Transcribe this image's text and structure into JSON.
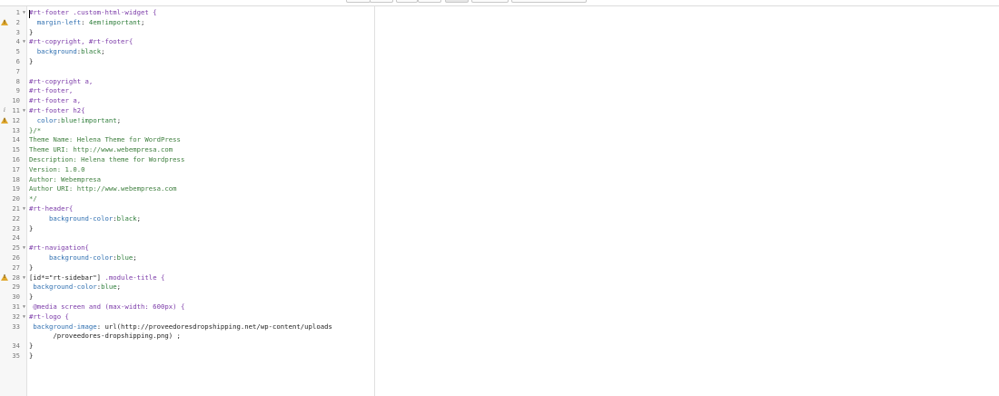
{
  "toolbar": {
    "buttons": [
      "",
      "",
      "",
      "",
      "",
      "",
      ""
    ]
  },
  "editor": {
    "lines": [
      {
        "num": "1",
        "fold": true,
        "parts": [
          {
            "t": "#rt-footer .custom-html-widget {",
            "c": "c-sel"
          }
        ]
      },
      {
        "num": "2",
        "warn": true,
        "parts": [
          {
            "t": "  margin-left",
            "c": "c-prop"
          },
          {
            "t": ": ",
            "c": "c-plain"
          },
          {
            "t": "4em!important",
            "c": "c-val"
          },
          {
            "t": ";",
            "c": "c-plain"
          }
        ]
      },
      {
        "num": "3",
        "parts": [
          {
            "t": "}",
            "c": "c-plain"
          }
        ]
      },
      {
        "num": "4",
        "fold": true,
        "parts": [
          {
            "t": "#rt-copyright, #rt-footer{",
            "c": "c-sel"
          }
        ]
      },
      {
        "num": "5",
        "parts": [
          {
            "t": "  background",
            "c": "c-prop"
          },
          {
            "t": ":",
            "c": "c-plain"
          },
          {
            "t": "black",
            "c": "c-val"
          },
          {
            "t": ";",
            "c": "c-plain"
          }
        ]
      },
      {
        "num": "6",
        "parts": [
          {
            "t": "}",
            "c": "c-plain"
          }
        ]
      },
      {
        "num": "7",
        "parts": [
          {
            "t": "",
            "c": "c-plain"
          }
        ]
      },
      {
        "num": "8",
        "parts": [
          {
            "t": "#rt-copyright a,",
            "c": "c-sel"
          }
        ]
      },
      {
        "num": "9",
        "parts": [
          {
            "t": "#rt-footer,",
            "c": "c-sel"
          }
        ]
      },
      {
        "num": "10",
        "parts": [
          {
            "t": "#rt-footer a,",
            "c": "c-sel"
          }
        ]
      },
      {
        "num": "11",
        "fold": true,
        "info": true,
        "parts": [
          {
            "t": "#rt-footer h2{",
            "c": "c-sel"
          }
        ]
      },
      {
        "num": "12",
        "warn": true,
        "parts": [
          {
            "t": "  color",
            "c": "c-prop"
          },
          {
            "t": ":",
            "c": "c-plain"
          },
          {
            "t": "blue!important",
            "c": "c-val"
          },
          {
            "t": ";",
            "c": "c-plain"
          }
        ]
      },
      {
        "num": "13",
        "parts": [
          {
            "t": "}/*",
            "c": "c-com"
          }
        ]
      },
      {
        "num": "14",
        "parts": [
          {
            "t": "Theme Name: Helena Theme for WordPress",
            "c": "c-com"
          }
        ]
      },
      {
        "num": "15",
        "parts": [
          {
            "t": "Theme URI: http://www.webempresa.com",
            "c": "c-com"
          }
        ]
      },
      {
        "num": "16",
        "parts": [
          {
            "t": "Description: Helena theme for Wordpress",
            "c": "c-com"
          }
        ]
      },
      {
        "num": "17",
        "parts": [
          {
            "t": "Version: 1.0.0",
            "c": "c-com"
          }
        ]
      },
      {
        "num": "18",
        "parts": [
          {
            "t": "Author: Webempresa",
            "c": "c-com"
          }
        ]
      },
      {
        "num": "19",
        "parts": [
          {
            "t": "Author URI: http://www.webempresa.com",
            "c": "c-com"
          }
        ]
      },
      {
        "num": "20",
        "parts": [
          {
            "t": "*/",
            "c": "c-com"
          }
        ]
      },
      {
        "num": "21",
        "fold": true,
        "parts": [
          {
            "t": "#rt-header{",
            "c": "c-sel"
          }
        ]
      },
      {
        "num": "22",
        "parts": [
          {
            "t": "     background-color",
            "c": "c-prop"
          },
          {
            "t": ":",
            "c": "c-plain"
          },
          {
            "t": "black",
            "c": "c-val"
          },
          {
            "t": ";",
            "c": "c-plain"
          }
        ]
      },
      {
        "num": "23",
        "parts": [
          {
            "t": "}",
            "c": "c-plain"
          }
        ]
      },
      {
        "num": "24",
        "parts": [
          {
            "t": "",
            "c": "c-plain"
          }
        ]
      },
      {
        "num": "25",
        "fold": true,
        "parts": [
          {
            "t": "#rt-navigation{",
            "c": "c-sel"
          }
        ]
      },
      {
        "num": "26",
        "parts": [
          {
            "t": "     background-color",
            "c": "c-prop"
          },
          {
            "t": ":",
            "c": "c-plain"
          },
          {
            "t": "blue",
            "c": "c-val"
          },
          {
            "t": ";",
            "c": "c-plain"
          }
        ]
      },
      {
        "num": "27",
        "parts": [
          {
            "t": "}",
            "c": "c-plain"
          }
        ]
      },
      {
        "num": "28",
        "fold": true,
        "warn": true,
        "parts": [
          {
            "t": "[id*=\"rt-sidebar\"] ",
            "c": "c-plain"
          },
          {
            "t": ".module-title {",
            "c": "c-sel"
          }
        ]
      },
      {
        "num": "29",
        "parts": [
          {
            "t": " background-color",
            "c": "c-prop"
          },
          {
            "t": ":",
            "c": "c-plain"
          },
          {
            "t": "blue",
            "c": "c-val"
          },
          {
            "t": ";",
            "c": "c-plain"
          }
        ]
      },
      {
        "num": "30",
        "parts": [
          {
            "t": "}",
            "c": "c-plain"
          }
        ]
      },
      {
        "num": "31",
        "fold": true,
        "parts": [
          {
            "t": " @media screen and (max-width: 600px) {",
            "c": "c-sel"
          }
        ]
      },
      {
        "num": "32",
        "fold": true,
        "parts": [
          {
            "t": "#rt-logo {",
            "c": "c-sel"
          }
        ]
      },
      {
        "num": "33",
        "parts": [
          {
            "t": " background-image",
            "c": "c-prop"
          },
          {
            "t": ": ",
            "c": "c-plain"
          },
          {
            "t": "url(http://proveedoresdropshipping.net/wp-content/uploads",
            "c": "c-plain"
          }
        ]
      },
      {
        "num": "",
        "parts": [
          {
            "t": "      /proveedores-dropshipping.png) ;",
            "c": "c-plain"
          }
        ]
      },
      {
        "num": "34",
        "parts": [
          {
            "t": "}",
            "c": "c-plain"
          }
        ]
      },
      {
        "num": "35",
        "parts": [
          {
            "t": "}",
            "c": "c-plain"
          }
        ]
      }
    ]
  }
}
